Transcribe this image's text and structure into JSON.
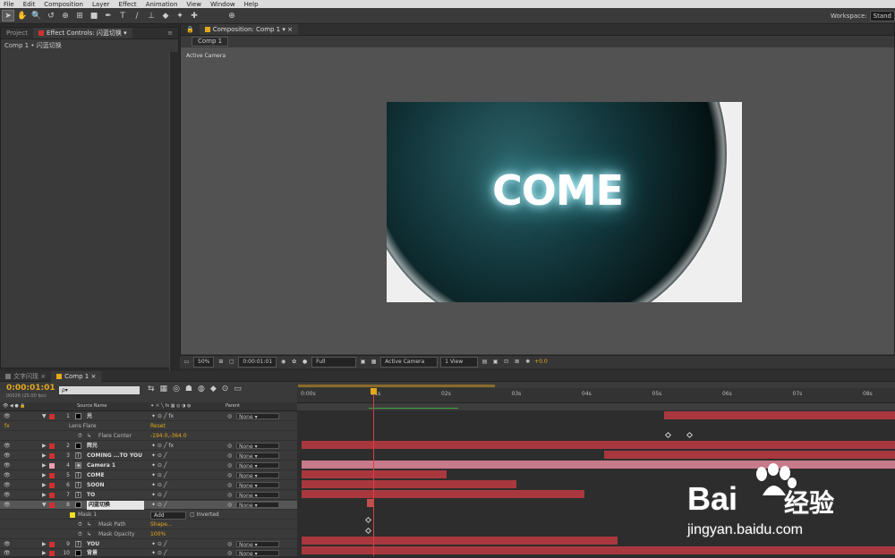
{
  "menu": [
    "File",
    "Edit",
    "Composition",
    "Layer",
    "Effect",
    "Animation",
    "View",
    "Window",
    "Help"
  ],
  "toolbar": {
    "tools": [
      "selection-tool",
      "hand-tool",
      "zoom-tool",
      "rotate-tool",
      "camera-tool",
      "pan-behind-tool",
      "rectangle-tool",
      "pen-tool",
      "text-tool",
      "brush-tool",
      "clone-tool",
      "eraser-tool",
      "roto-tool",
      "puppet-tool",
      "axis-tool"
    ],
    "workspace_label": "Workspace:",
    "workspace_value": "Stand"
  },
  "left_panel": {
    "tab_project": "Project",
    "tab_effect_controls": "Effect Controls: 闪蓝切换",
    "breadcrumb": "Comp 1 • 闪蓝切换"
  },
  "comp_panel": {
    "tab": "Composition: Comp 1",
    "sub_tab": "Comp 1",
    "view_label": "Active Camera",
    "text": "COME",
    "bottom_bar": {
      "zoom": "50%",
      "time": "0:00:01:01",
      "resolution": "Full",
      "camera": "Active Camera",
      "views": "1 View",
      "exposure": "+0.0"
    }
  },
  "timeline": {
    "tabs": [
      "文字闪现",
      "Comp 1"
    ],
    "timecode": "0:00:01:01",
    "fps": "00026 (25.00 fps)",
    "search_placeholder": "ρ▾",
    "columns": {
      "source_name": "Source Name",
      "parent": "Parent"
    },
    "ruler": [
      "0:00s",
      "01s",
      "02s",
      "03s",
      "04s",
      "05s",
      "06s",
      "07s",
      "08s"
    ],
    "layers": [
      {
        "num": "1",
        "name": "光",
        "color": "#d03030",
        "type": "solid",
        "parent": "None",
        "fx": true
      },
      {
        "prop": "Lens Flare",
        "value": "Reset",
        "kind": "effect"
      },
      {
        "prop": "Flare Center",
        "value": "-194.0,-364.0",
        "kind": "param"
      },
      {
        "num": "2",
        "name": "辉光",
        "color": "#d03030",
        "type": "solid",
        "parent": "None",
        "fx": true
      },
      {
        "num": "3",
        "name": "COMING ...TO YOU",
        "color": "#d03030",
        "type": "text",
        "parent": "None"
      },
      {
        "num": "4",
        "name": "Camera 1",
        "color": "#e8a0b0",
        "type": "camera",
        "parent": "None"
      },
      {
        "num": "5",
        "name": "COME",
        "color": "#d03030",
        "type": "text",
        "parent": "None"
      },
      {
        "num": "6",
        "name": "SOON",
        "color": "#d03030",
        "type": "text",
        "parent": "None"
      },
      {
        "num": "7",
        "name": "TO",
        "color": "#d03030",
        "type": "text",
        "parent": "None"
      },
      {
        "num": "8",
        "name": "闪蓝切换",
        "color": "#d03030",
        "type": "solid",
        "parent": "None",
        "selected": true
      },
      {
        "prop": "Mask 1",
        "value": "Add",
        "extra": "Inverted",
        "kind": "mask"
      },
      {
        "prop": "Mask Path",
        "value": "Shape...",
        "kind": "param"
      },
      {
        "prop": "Mask Opacity",
        "value": "100%",
        "kind": "param"
      },
      {
        "num": "9",
        "name": "YOU",
        "color": "#d03030",
        "type": "text",
        "parent": "None"
      },
      {
        "num": "10",
        "name": "背景",
        "color": "#d03030",
        "type": "solid",
        "parent": "None"
      }
    ]
  },
  "watermark": {
    "brand": "Bai",
    "brand2": "经验",
    "url": "jingyan.baidu.com"
  },
  "colors": {
    "accent": "#e3a81b",
    "bar_red": "#a8383e",
    "bar_pink": "#c77a8a",
    "cti": "#e23b3b"
  }
}
